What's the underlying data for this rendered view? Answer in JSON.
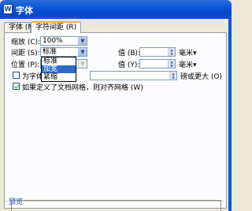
{
  "window": {
    "title": "字体",
    "app_icon": "W"
  },
  "tabs": [
    {
      "label": "字体 (N)",
      "active": false
    },
    {
      "label": "字符间距 (R)",
      "active": true
    }
  ],
  "scale": {
    "label": "缩放 (C):",
    "value": "100%"
  },
  "spacing": {
    "label": "间距 (S):",
    "value": "标准",
    "options": [
      "标准",
      "加宽",
      "紧缩"
    ],
    "highlighted": "加宽",
    "value_label": "值 (B):",
    "unit": "毫米"
  },
  "position": {
    "label": "位置 (P):",
    "value_label": "值 (Y):",
    "unit": "毫米"
  },
  "kerning": {
    "label": "为字体",
    "suffix": "磅或更大 (O)",
    "checked": false
  },
  "snap_grid": {
    "label": "如果定义了文档网格，则对齐网格 (W)",
    "checked": true
  },
  "preview": {
    "label": "预览"
  },
  "colors": {
    "title_bar": "#0a56d8",
    "accent": "#f0b030",
    "selection": "#316ac5",
    "preview_label": "#1a4fc8"
  }
}
